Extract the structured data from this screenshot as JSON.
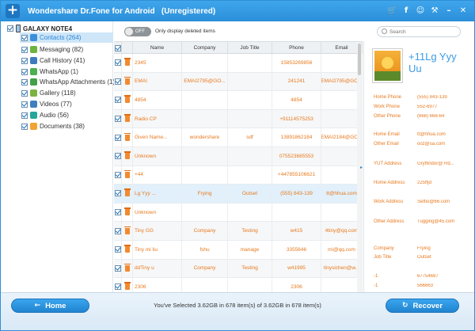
{
  "app": {
    "title": "Wondershare Dr.Fone for Android   (Unregistered)",
    "titlebar_icons": [
      "cart-icon",
      "facebook-icon",
      "chat-icon",
      "wrench-icon",
      "minimize-icon",
      "close-icon"
    ],
    "titlebar_glyphs": [
      "🛒",
      "f",
      "☺",
      "⚒",
      "–",
      "✕"
    ]
  },
  "sidebar": {
    "device": "GALAXY NOTE4",
    "items": [
      {
        "label": "Contacts (264)",
        "color": "#3a8fd8",
        "selected": true
      },
      {
        "label": "Messaging (82)",
        "color": "#6cb33f"
      },
      {
        "label": "Call History (41)",
        "color": "#3d7bbd"
      },
      {
        "label": "WhatsApp (1)",
        "color": "#4caf50"
      },
      {
        "label": "WhatsApp Attachments (1)",
        "color": "#43a047"
      },
      {
        "label": "Gallery (118)",
        "color": "#7cb342"
      },
      {
        "label": "Videos (77)",
        "color": "#3f7fbf"
      },
      {
        "label": "Audio (56)",
        "color": "#26a69a"
      },
      {
        "label": "Documents (38)",
        "color": "#f2a233"
      }
    ]
  },
  "toolbar": {
    "toggle_text": "OFF",
    "toggle_label": "Only display deleted items",
    "search_placeholder": "Search"
  },
  "table": {
    "headers": [
      "Name",
      "Company",
      "Job Title",
      "Phone",
      "Email"
    ],
    "rows": [
      [
        "2345",
        "",
        "",
        "15853269856",
        ""
      ],
      [
        "EMAI",
        "EMAI2795@GO...",
        "",
        "241241",
        "EMAI2795@GO..."
      ],
      [
        "4854",
        "",
        "",
        "4854",
        ""
      ],
      [
        "Radio CP",
        "",
        "",
        "+91114575253",
        ""
      ],
      [
        "Given Name...",
        "wondershare",
        "sdf",
        "13891862184",
        "EMAI2184@GO..."
      ],
      [
        "Unknown",
        "",
        "",
        "075523685553",
        ""
      ],
      [
        "+44",
        "",
        "",
        "+447855106621",
        ""
      ],
      [
        "Lg Yyy ...",
        "Frying",
        "Outset",
        "(555) 843-139",
        "tt@hhua.com"
      ],
      [
        "Unknown",
        "",
        "",
        "",
        ""
      ],
      [
        "Tiny GG",
        "Company",
        "Testing",
        "w415",
        "4tiny@qq.com"
      ],
      [
        "Tiny mi liu",
        "fshu",
        "manage",
        "3355646",
        "mi@qq.com"
      ],
      [
        "ddTiny u",
        "Company",
        "Testing",
        "w41995",
        "tinysichen@w..."
      ],
      [
        "2306",
        "",
        "",
        "2306",
        ""
      ]
    ]
  },
  "detail": {
    "name": "+11Lg Yyy Uu",
    "fields": [
      {
        "label": "Home Phone",
        "value": "(555) 843-139"
      },
      {
        "label": "Work Phone",
        "value": "552-6977"
      },
      {
        "label": "Other Phone",
        "value": "(668) 668-64"
      },
      {
        "label": "Home Email",
        "value": "tt@hhua.com"
      },
      {
        "label": "Other Email",
        "value": "ooz@sa.com"
      },
      {
        "label": "YUT Address",
        "value": "Gryffindor@ Rd..."
      },
      {
        "label": "Home Address",
        "value": "225ffjd"
      },
      {
        "label": "Work Address",
        "value": "Settio@66.com"
      },
      {
        "label": "Other Address",
        "value": "Tugging@45.com"
      },
      {
        "label": "Company",
        "value": "Frying"
      },
      {
        "label": "Job Title",
        "value": "Outset"
      },
      {
        "label": "-1",
        "value": "67754687"
      },
      {
        "label": "-1",
        "value": "566663"
      }
    ]
  },
  "footer": {
    "home_label": "Home",
    "recover_label": "Recover",
    "status": "You've Selected 3.62GB in 678 item(s) of 3.62GB in 678 item(s)"
  }
}
